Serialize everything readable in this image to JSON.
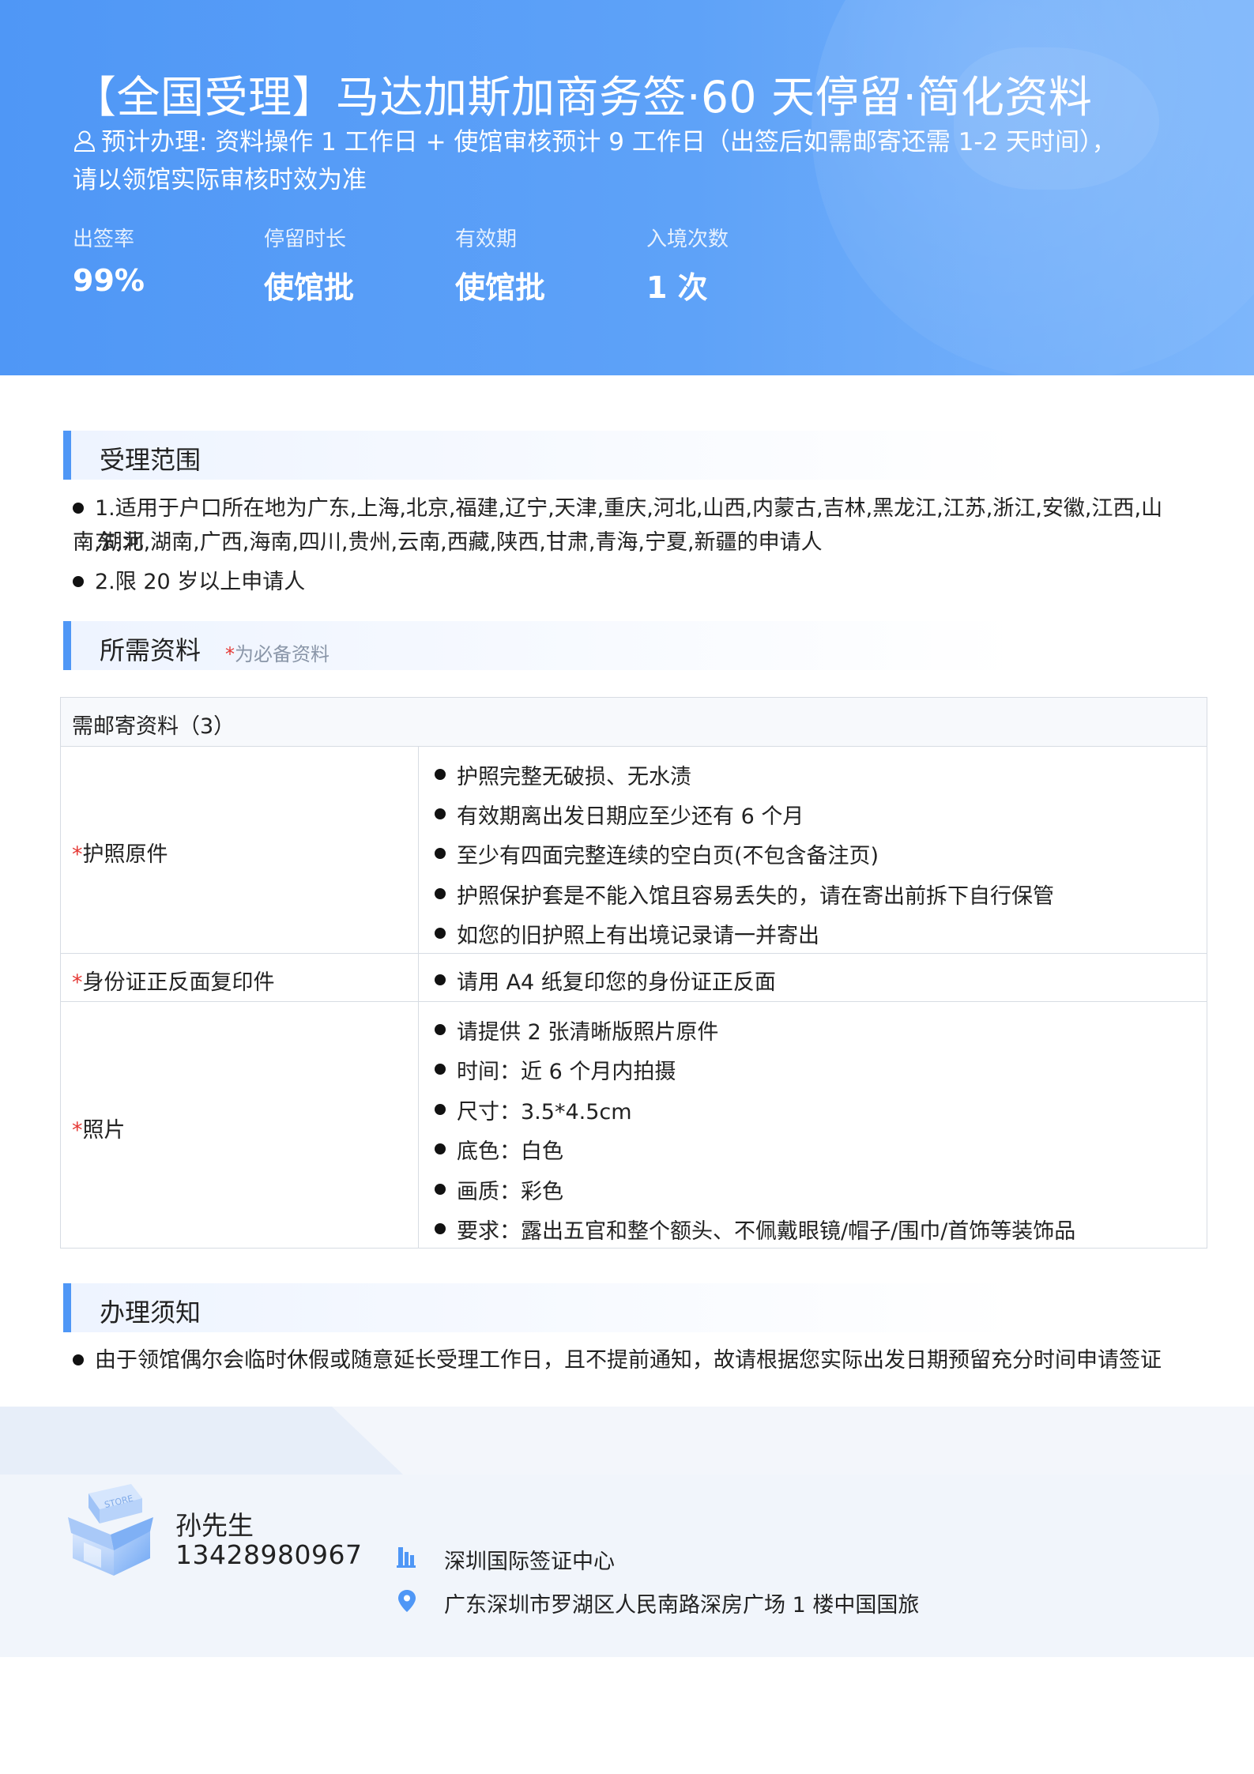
{
  "header": {
    "title": "【全国受理】马达加斯加商务签·60 天停留·简化资料",
    "meta_line1": "预计办理: 资料操作 1 工作日 + 使馆审核预计 9 工作日（出签后如需邮寄还需 1-2 天时间），",
    "meta_line2": "请以领馆实际审核时效为准",
    "stats": [
      {
        "label": "出签率",
        "value": "99%"
      },
      {
        "label": "停留时长",
        "value": "使馆批"
      },
      {
        "label": "有效期",
        "value": "使馆批"
      },
      {
        "label": "入境次数",
        "value": "1 次"
      }
    ]
  },
  "scope": {
    "title": "受理范围",
    "items": [
      {
        "line1": "1.适用于户口所在地为广东,上海,北京,福建,辽宁,天津,重庆,河北,山西,内蒙古,吉林,黑龙江,江苏,浙江,安徽,江西,山东,河",
        "line2": "南,湖北,湖南,广西,海南,四川,贵州,云南,西藏,陕西,甘肃,青海,宁夏,新疆的申请人"
      },
      {
        "line1": "2.限 20 岁以上申请人"
      }
    ]
  },
  "materials": {
    "title": "所需资料",
    "note_star": "*",
    "note_text": "为必备资料",
    "table_header": "需邮寄资料（3）",
    "rows": [
      {
        "star": "*",
        "name": "护照原件",
        "items": [
          "护照完整无破损、无水渍",
          "有效期离出发日期应至少还有 6 个月",
          "至少有四面完整连续的空白页(不包含备注页)",
          "护照保护套是不能入馆且容易丢失的，请在寄出前拆下自行保管",
          "如您的旧护照上有出境记录请一并寄出"
        ]
      },
      {
        "star": "*",
        "name": "身份证正反面复印件",
        "items": [
          "请用 A4 纸复印您的身份证正反面"
        ]
      },
      {
        "star": "*",
        "name": "照片",
        "items": [
          "请提供 2 张清晰版照片原件",
          "时间：近 6 个月内拍摄",
          "尺寸：3.5*4.5cm",
          "底色：白色",
          "画质：彩色",
          "要求：露出五官和整个额头、不佩戴眼镜/帽子/围巾/首饰等装饰品"
        ]
      }
    ]
  },
  "notice": {
    "title": "办理须知",
    "items": [
      "由于领馆偶尔会临时休假或随意延长受理工作日，且不提前通知，故请根据您实际出发日期预留充分时间申请签证"
    ]
  },
  "footer": {
    "store_sign": "STORE",
    "contact_name": "孙先生",
    "contact_phone": "13428980967",
    "agency": "深圳国际签证中心",
    "address": "广东深圳市罗湖区人民南路深房广场 1 楼中国国旅"
  },
  "colors": {
    "accent": "#4f97f6",
    "required_star": "#e53935"
  }
}
